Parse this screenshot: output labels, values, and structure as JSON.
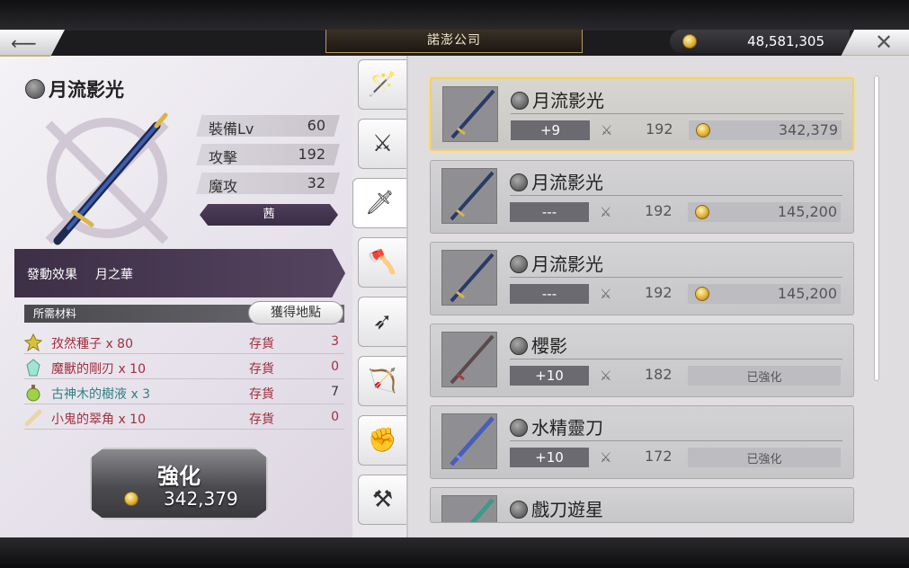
{
  "header": {
    "shop_title": "諾澎公司",
    "gold": "48,581,305",
    "back_label": "⟵",
    "close_label": "✕"
  },
  "weapon": {
    "name": "月流影光",
    "stats": [
      {
        "label": "裝備Lv",
        "value": "60"
      },
      {
        "label": "攻擊",
        "value": "192"
      },
      {
        "label": "魔攻",
        "value": "32"
      }
    ],
    "owner": "茜",
    "effect_label": "發動效果",
    "effect_value": "月之華"
  },
  "materials": {
    "header": "所需材料",
    "obtain_label": "獲得地點",
    "items": [
      {
        "name": "孜然種子 x 80",
        "stock_label": "存貨",
        "count": "3",
        "icon": "seed-icon"
      },
      {
        "name": "魔獸的剛刃 x 10",
        "stock_label": "存貨",
        "count": "0",
        "icon": "crystal-icon"
      },
      {
        "name": "古神木的樹液 x 3",
        "stock_label": "存貨",
        "count": "7",
        "icon": "potion-icon"
      },
      {
        "name": "小鬼的翠角 x 10",
        "stock_label": "存貨",
        "count": "0",
        "icon": "bone-icon"
      }
    ]
  },
  "enhance": {
    "label": "強化",
    "cost": "342,379"
  },
  "tabs": [
    "staff-icon",
    "sword-icon",
    "blade-icon",
    "axe-icon",
    "spear-icon",
    "bow-icon",
    "gauntlet-icon",
    "hammer-icon"
  ],
  "list": [
    {
      "name": "月流影光",
      "level": "+9",
      "atk": "192",
      "cost": "342,379",
      "status": ""
    },
    {
      "name": "月流影光",
      "level": "---",
      "atk": "192",
      "cost": "145,200",
      "status": ""
    },
    {
      "name": "月流影光",
      "level": "---",
      "atk": "192",
      "cost": "145,200",
      "status": ""
    },
    {
      "name": "櫻影",
      "level": "+10",
      "atk": "182",
      "cost": "",
      "status": "已強化"
    },
    {
      "name": "水精靈刀",
      "level": "+10",
      "atk": "172",
      "cost": "",
      "status": "已強化"
    },
    {
      "name": "戲刀遊星",
      "level": "",
      "atk": "",
      "cost": "",
      "status": ""
    }
  ]
}
